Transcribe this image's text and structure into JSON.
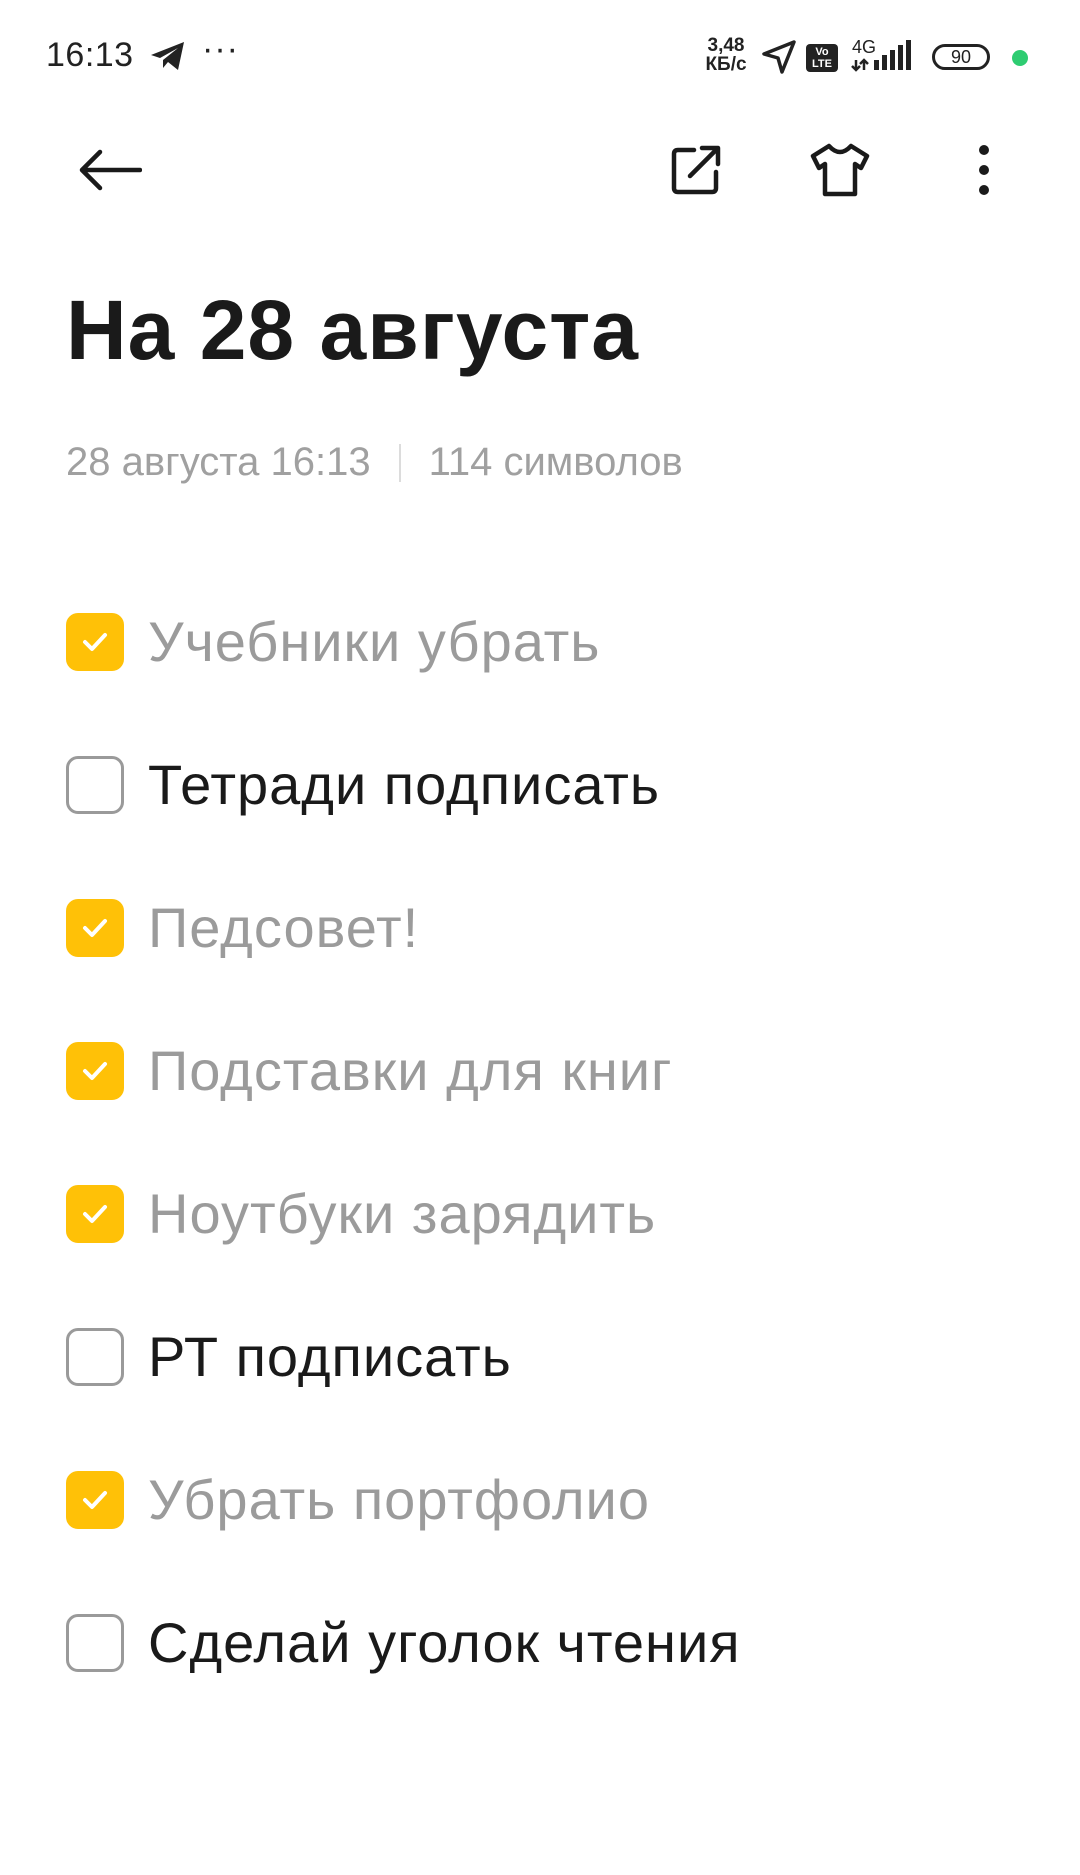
{
  "status_bar": {
    "time": "16:13",
    "dots": "···",
    "net_speed_value": "3,48",
    "net_speed_unit": "КБ/с",
    "volte": "Vo LTE",
    "network": "4G",
    "battery": "90",
    "icons": [
      "telegram-icon",
      "location-arrow-icon",
      "signal-icon",
      "battery-icon"
    ]
  },
  "toolbar": {
    "icons": [
      "back-arrow-icon",
      "share-icon",
      "theme-shirt-icon",
      "more-vertical-icon"
    ]
  },
  "note": {
    "title": "На 28 августа",
    "date": "28 августа 16:13",
    "char_count": "114 символов",
    "items": [
      {
        "text": "Учебники убрать",
        "checked": true
      },
      {
        "text": "Тетради подписать",
        "checked": false
      },
      {
        "text": "Педсовет!",
        "checked": true
      },
      {
        "text": "Подставки для книг",
        "checked": true
      },
      {
        "text": "Ноутбуки зарядить",
        "checked": true
      },
      {
        "text": "РТ подписать",
        "checked": false
      },
      {
        "text": "Убрать портфолио",
        "checked": true
      },
      {
        "text": "Сделай уголок чтения",
        "checked": false
      }
    ]
  },
  "colors": {
    "accent": "#ffc107",
    "done_text": "#9b9b9b",
    "meta_text": "#a0a0a0",
    "status_dot": "#2ecc71"
  }
}
